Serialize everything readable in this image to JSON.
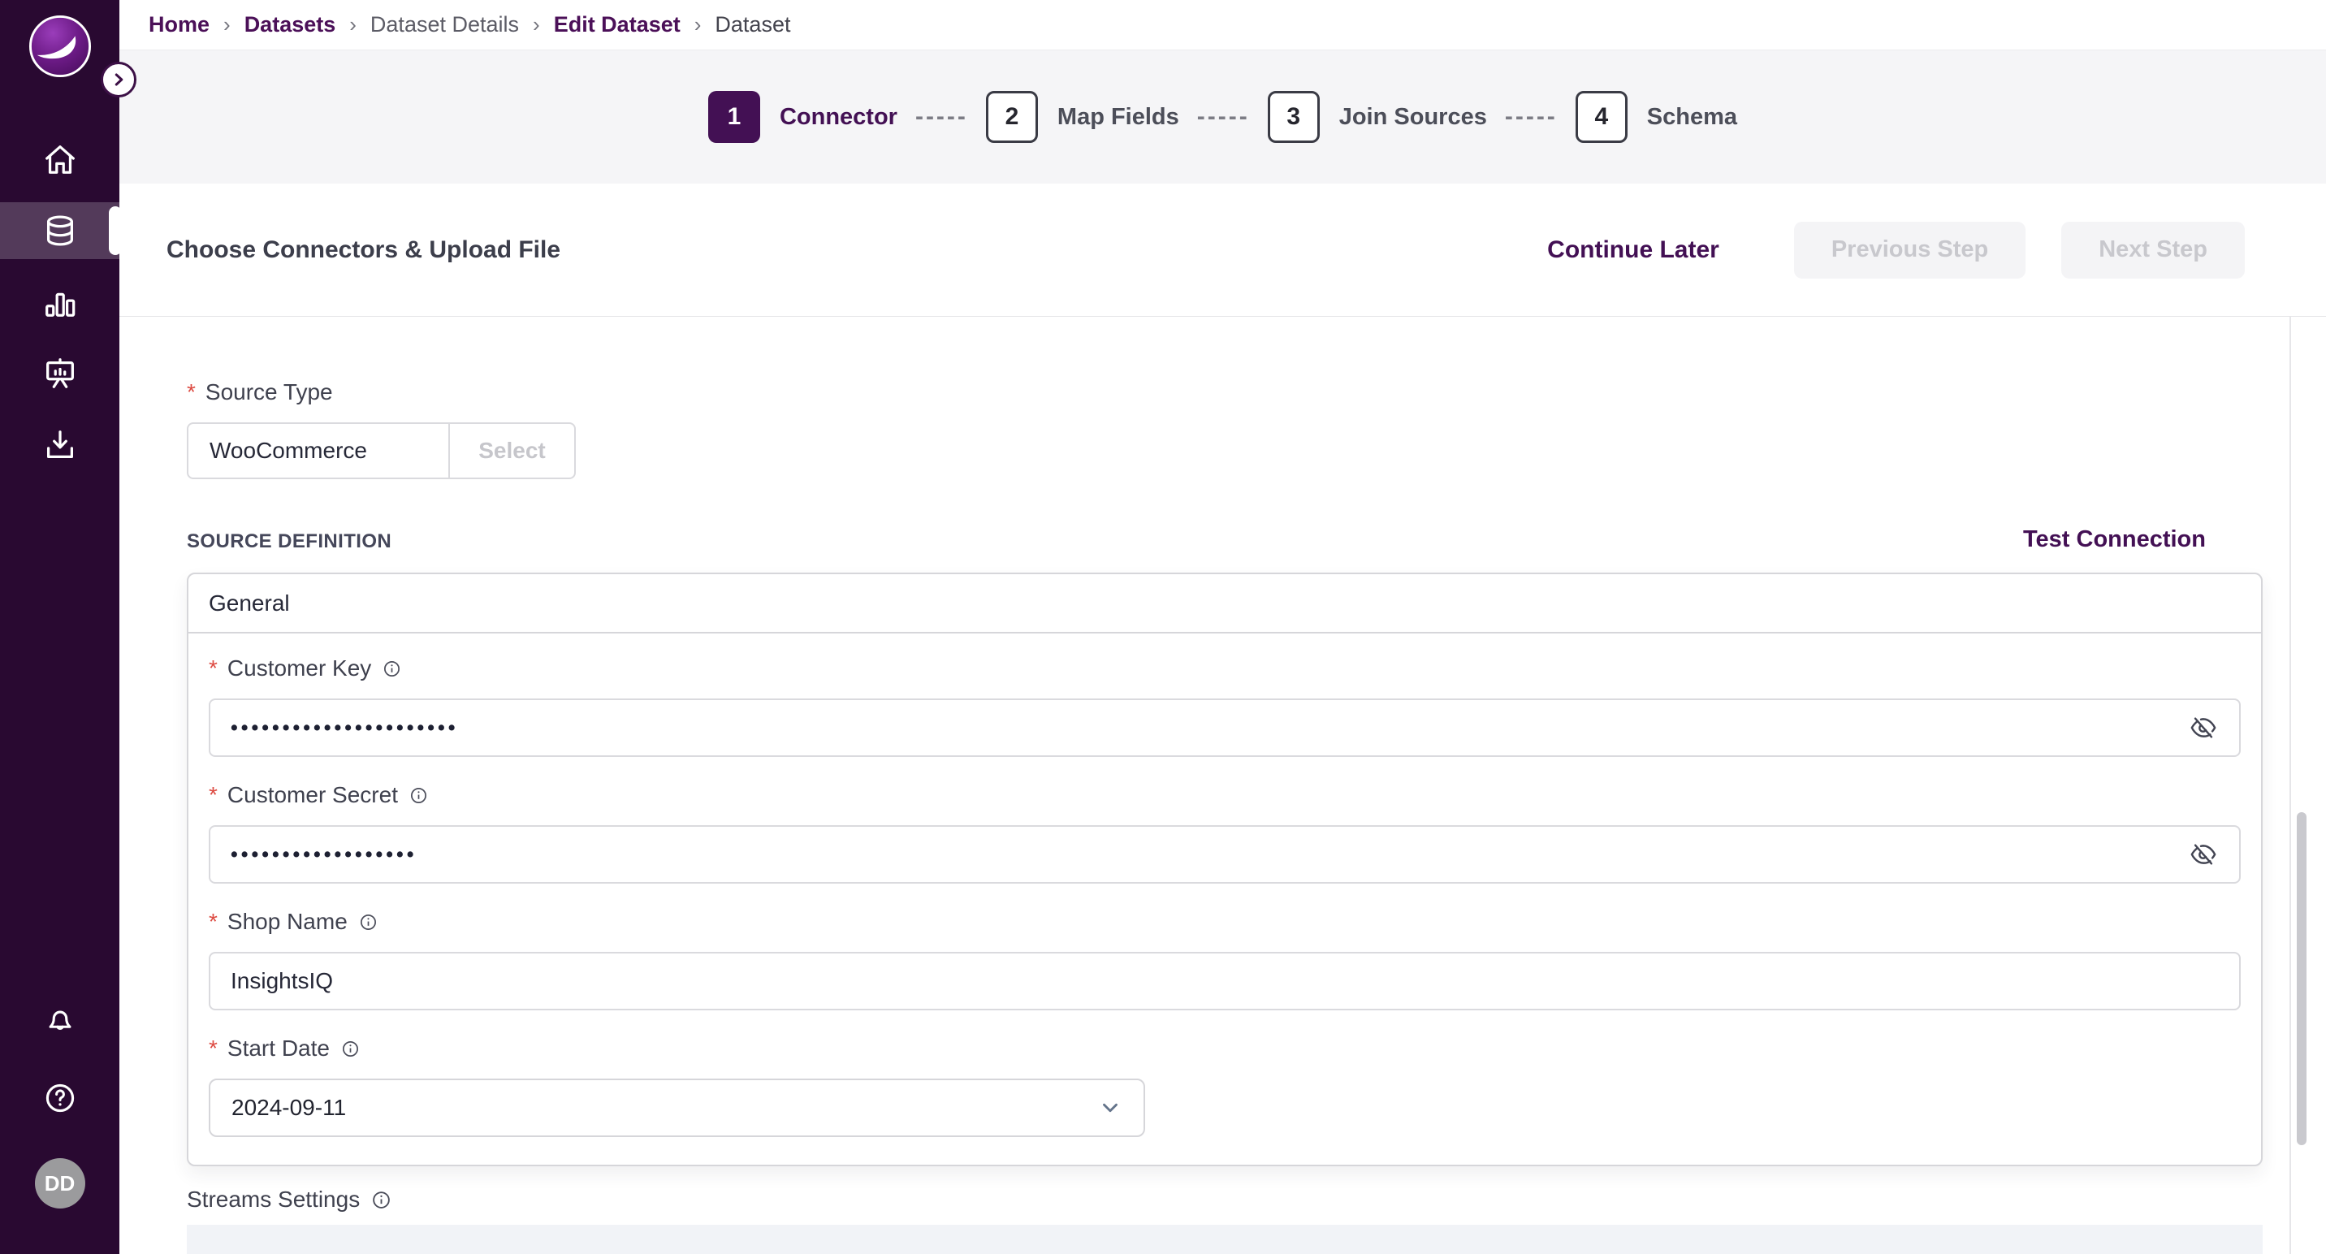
{
  "colors": {
    "accent_purple": "#431054",
    "sidebar_bg": "#290931",
    "required_red": "#dd4b42",
    "disabled_button_bg": "#f4f4f6",
    "disabled_button_text": "#c8c8cd",
    "stepper_band_bg": "#f5f5f7"
  },
  "sidebar": {
    "avatar_initials": "DD",
    "items": [
      {
        "icon": "home-icon",
        "active": false
      },
      {
        "icon": "database-icon",
        "active": true
      },
      {
        "icon": "bar-chart-icon",
        "active": false
      },
      {
        "icon": "presentation-icon",
        "active": false
      },
      {
        "icon": "download-icon",
        "active": false
      }
    ],
    "footer_icons": [
      "bell-icon",
      "help-icon"
    ]
  },
  "breadcrumb": {
    "separator": "›",
    "items": [
      {
        "label": "Home",
        "style": "link"
      },
      {
        "label": "Datasets",
        "style": "link"
      },
      {
        "label": "Dataset Details",
        "style": "muted"
      },
      {
        "label": "Edit Dataset",
        "style": "link"
      },
      {
        "label": "Dataset",
        "style": "current"
      }
    ]
  },
  "stepper": {
    "connector_dashes": "-----",
    "steps": [
      {
        "number": "1",
        "label": "Connector",
        "active": true
      },
      {
        "number": "2",
        "label": "Map Fields",
        "active": false
      },
      {
        "number": "3",
        "label": "Join Sources",
        "active": false
      },
      {
        "number": "4",
        "label": "Schema",
        "active": false
      }
    ]
  },
  "header": {
    "title": "Choose Connectors & Upload File",
    "continue_later_label": "Continue Later",
    "previous_step_label": "Previous Step",
    "next_step_label": "Next Step"
  },
  "form": {
    "source_type": {
      "label": "Source Type",
      "value": "WooCommerce",
      "select_button_label": "Select"
    },
    "section_title": "SOURCE DEFINITION",
    "test_connection_label": "Test Connection",
    "group_title": "General",
    "customer_key": {
      "label": "Customer Key",
      "masked_value": "••••••••••••••••••••••"
    },
    "customer_secret": {
      "label": "Customer Secret",
      "masked_value": "••••••••••••••••••"
    },
    "shop_name": {
      "label": "Shop Name",
      "value": "InsightsIQ"
    },
    "start_date": {
      "label": "Start Date",
      "value": "2024-09-11"
    },
    "streams_settings_label": "Streams Settings"
  }
}
